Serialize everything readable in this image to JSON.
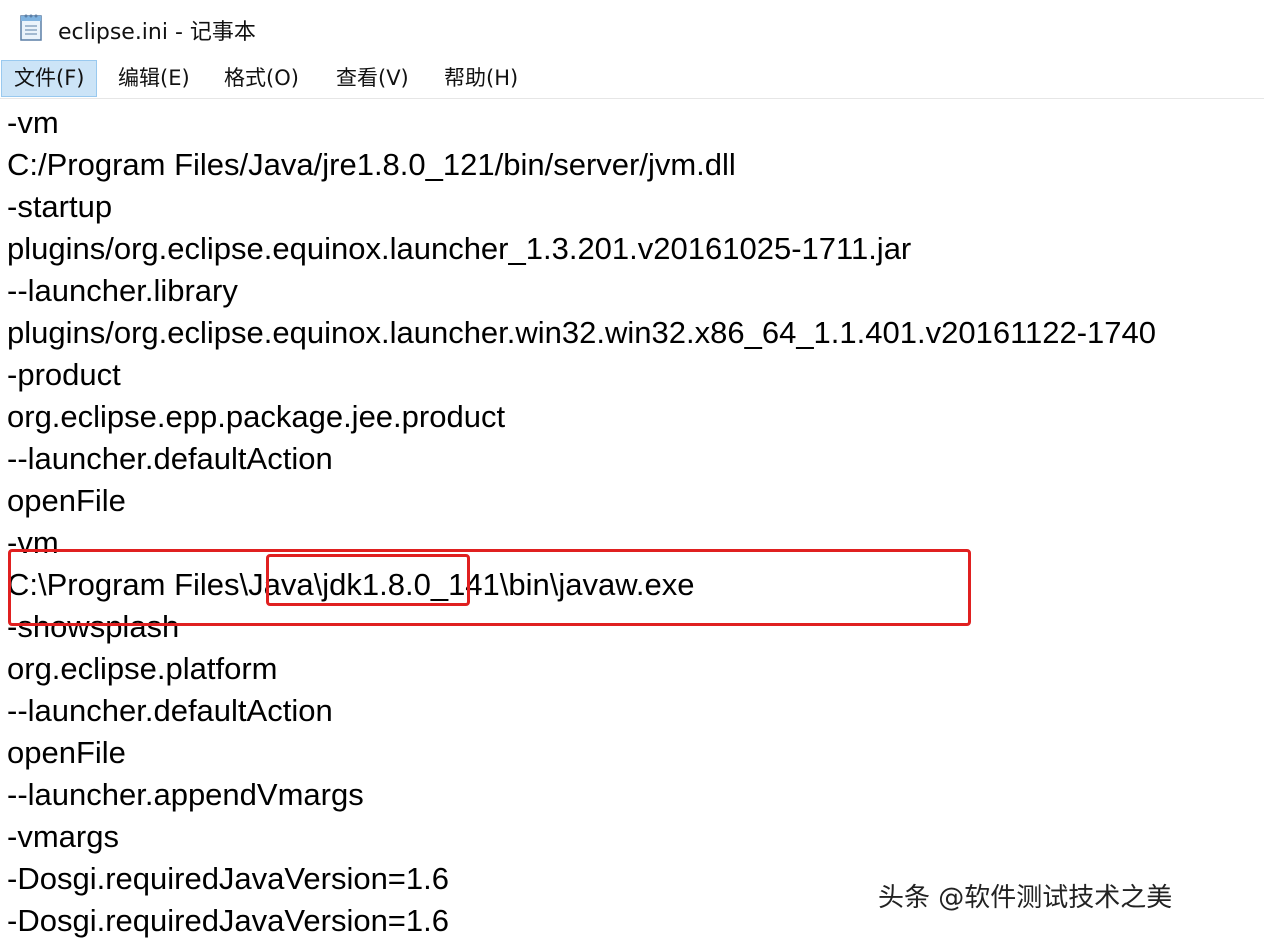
{
  "window": {
    "title": "eclipse.ini - 记事本",
    "icon": "notepad-icon"
  },
  "menu": {
    "items": [
      {
        "label": "文件(F)",
        "active": true
      },
      {
        "label": "编辑(E)",
        "active": false
      },
      {
        "label": "格式(O)",
        "active": false
      },
      {
        "label": "查看(V)",
        "active": false
      },
      {
        "label": "帮助(H)",
        "active": false
      }
    ]
  },
  "editor": {
    "lines": [
      "-vm",
      "C:/Program Files/Java/jre1.8.0_121/bin/server/jvm.dll",
      "-startup",
      "plugins/org.eclipse.equinox.launcher_1.3.201.v20161025-1711.jar",
      "--launcher.library",
      "plugins/org.eclipse.equinox.launcher.win32.win32.x86_64_1.1.401.v20161122-1740",
      "-product",
      "org.eclipse.epp.package.jee.product",
      "--launcher.defaultAction",
      "openFile",
      "-vm",
      "C:\\Program Files\\Java\\jdk1.8.0_141\\bin\\javaw.exe",
      "-showsplash",
      "org.eclipse.platform",
      "--launcher.defaultAction",
      "openFile",
      "--launcher.appendVmargs",
      "-vmargs",
      "-Dosgi.requiredJavaVersion=1.6",
      "-Dosgi.requiredJavaVersion=1.6"
    ]
  },
  "annotation": {
    "color": "#e02020"
  },
  "watermark": {
    "text": "头条 @软件测试技术之美"
  }
}
